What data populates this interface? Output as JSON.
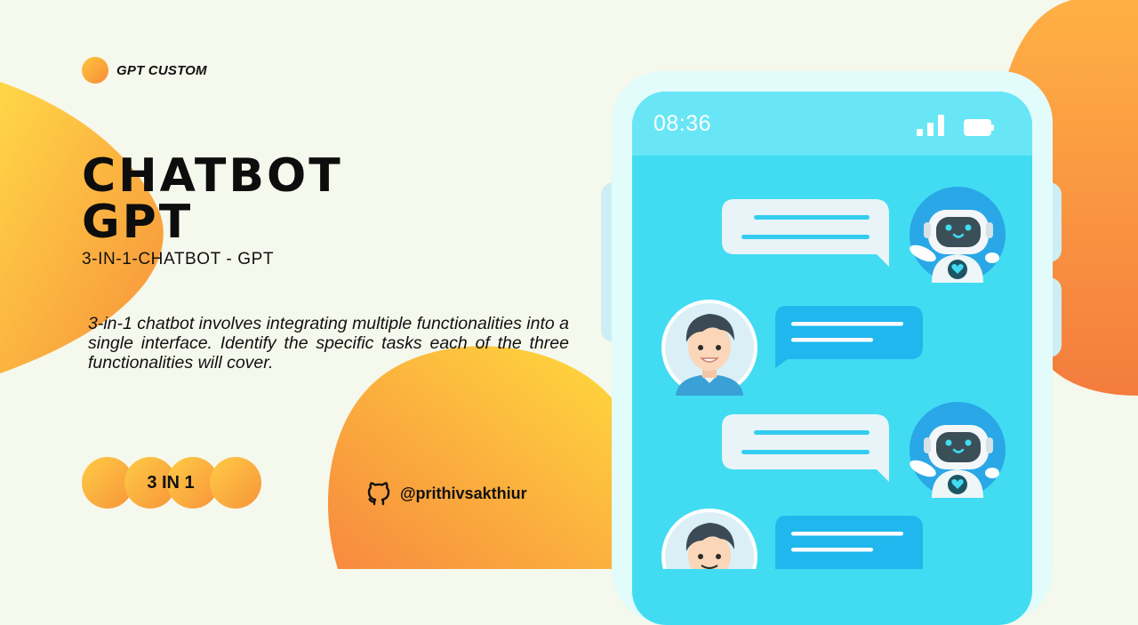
{
  "brand": {
    "label": "GPT CUSTOM",
    "dot_icon": "circle-dot-icon"
  },
  "hero": {
    "title_line1": "CHATBOT",
    "title_line2": "GPT",
    "subtitle": "3-IN-1-CHATBOT - GPT",
    "description": "3-in-1 chatbot involves integrating multiple functionalities into a single interface. Identify the specific tasks each of the three functionalities will cover."
  },
  "badge": {
    "label": "3 IN 1"
  },
  "github": {
    "handle": "@prithivsakthiur",
    "icon": "github-icon"
  },
  "phone": {
    "time": "08:36",
    "status_icons": [
      "signal-icon",
      "battery-icon"
    ],
    "messages": [
      {
        "sender": "bot",
        "avatar": "robot-avatar-icon"
      },
      {
        "sender": "user",
        "avatar": "user-avatar-icon"
      },
      {
        "sender": "bot",
        "avatar": "robot-avatar-icon"
      },
      {
        "sender": "user",
        "avatar": "user-avatar-icon"
      }
    ]
  },
  "colors": {
    "background": "#f5f8ec",
    "orange": "#f78b3a",
    "yellow": "#ffc53d",
    "screen": "#41dcf2",
    "status_bar": "#68e6f5",
    "user_bubble": "#1fb7ee",
    "bot_bubble": "#e9f4f8"
  }
}
